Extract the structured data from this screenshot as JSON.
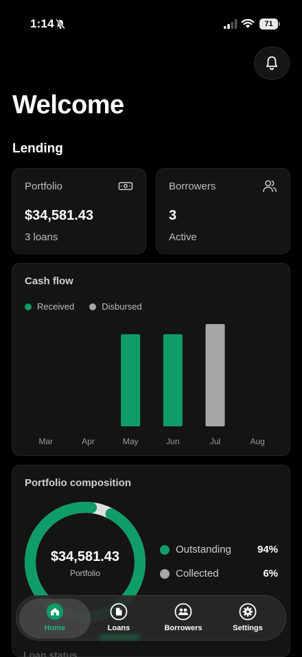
{
  "status_bar": {
    "time": "1:14",
    "battery": "71"
  },
  "header": {
    "welcome": "Welcome",
    "section": "Lending"
  },
  "cards": {
    "portfolio": {
      "label": "Portfolio",
      "value": "$34,581.43",
      "sub": "3 loans"
    },
    "borrowers": {
      "label": "Borrowers",
      "value": "3",
      "sub": "Active"
    }
  },
  "cash_flow": {
    "title": "Cash flow",
    "legend": {
      "received": "Received",
      "disbursed": "Disbursed"
    }
  },
  "colors": {
    "accent": "#0f9d67",
    "grey": "#a6a6a6",
    "track": "#e0e0e0"
  },
  "chart_data": {
    "type": "bar",
    "categories": [
      "Mar",
      "Apr",
      "May",
      "Jun",
      "Jul",
      "Aug"
    ],
    "series": [
      {
        "name": "Received",
        "values": [
          0,
          0,
          0.9,
          0.9,
          0,
          0
        ]
      },
      {
        "name": "Disbursed",
        "values": [
          0,
          0,
          0,
          0,
          1.0,
          0
        ]
      }
    ],
    "ylim": [
      0,
      1.0
    ],
    "legend_position": "top-left",
    "grid": false
  },
  "composition": {
    "title": "Portfolio composition",
    "center_value": "$34,581.43",
    "center_label": "Portfolio",
    "items": [
      {
        "name": "Outstanding",
        "pct": "94%",
        "fraction": 0.94
      },
      {
        "name": "Collected",
        "pct": "6%",
        "fraction": 0.06
      }
    ]
  },
  "nav": {
    "items": [
      {
        "label": "Home",
        "icon": "home-icon",
        "active": true
      },
      {
        "label": "Loans",
        "icon": "document-icon",
        "active": false
      },
      {
        "label": "Borrowers",
        "icon": "users-icon",
        "active": false
      },
      {
        "label": "Settings",
        "icon": "gear-icon",
        "active": false
      }
    ]
  },
  "footer_hint": "Loan status"
}
